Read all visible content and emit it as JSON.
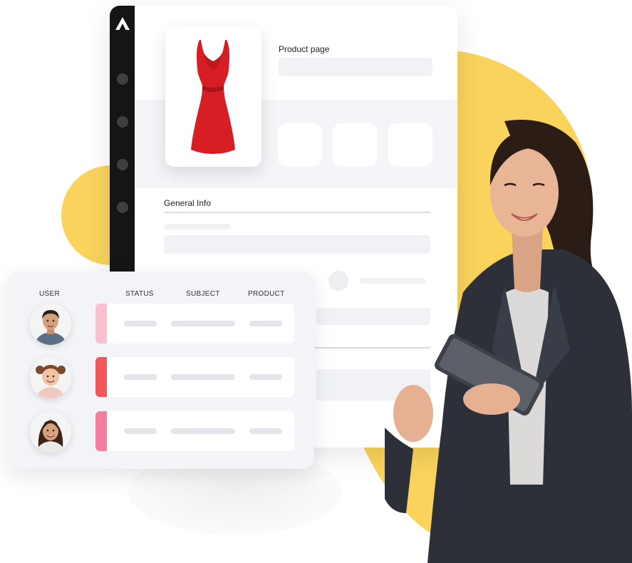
{
  "product_card": {
    "page_title": "Product page",
    "section_title": "General Info",
    "product_image": "red-dress"
  },
  "table": {
    "headers": [
      "USER",
      "STATUS",
      "SUBJECT",
      "PRODUCT"
    ],
    "rows": [
      {
        "avatar": "man-avatar",
        "status_color": "#f9c0cf"
      },
      {
        "avatar": "girl-avatar",
        "status_color": "#f2575a"
      },
      {
        "avatar": "woman-avatar",
        "status_color": "#f47ea0"
      }
    ]
  },
  "colors": {
    "accent_yellow": "#f9d35c",
    "sidebar_dark": "#151515",
    "dress_red": "#d81e25"
  },
  "photo": "businesswoman-with-tablet"
}
